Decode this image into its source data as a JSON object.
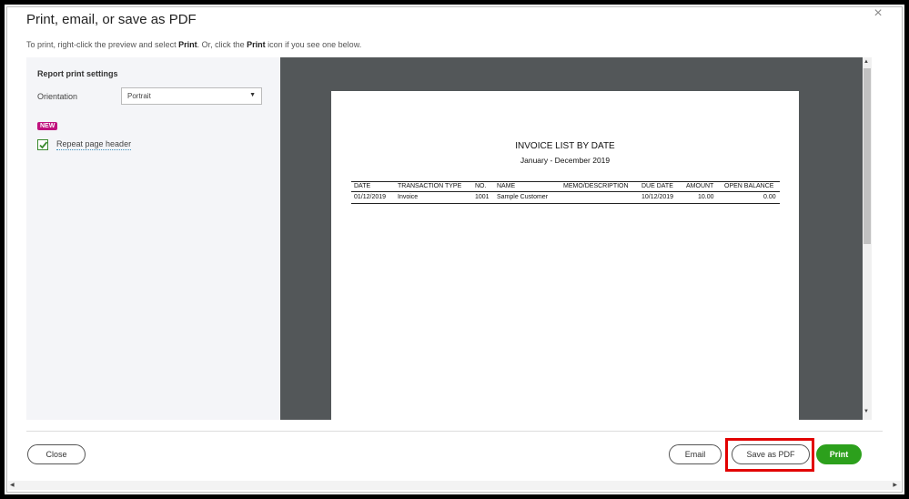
{
  "dialog": {
    "title": "Print, email, or save as PDF",
    "subtitle_pre": "To print, right-click the preview and select ",
    "subtitle_b1": "Print",
    "subtitle_mid": ". Or, click the ",
    "subtitle_b2": "Print",
    "subtitle_post": " icon if you see one below.",
    "close_icon": "×"
  },
  "settings": {
    "heading": "Report print settings",
    "orientation_label": "Orientation",
    "orientation_value": "Portrait",
    "new_badge": "NEW",
    "repeat_header_label": "Repeat page header",
    "repeat_header_checked": true
  },
  "report": {
    "title": "INVOICE LIST BY DATE",
    "subtitle": "January - December 2019",
    "columns": [
      "DATE",
      "TRANSACTION TYPE",
      "NO.",
      "NAME",
      "MEMO/DESCRIPTION",
      "DUE DATE",
      "AMOUNT",
      "OPEN BALANCE"
    ],
    "rows": [
      [
        "01/12/2019",
        "Invoice",
        "1001",
        "Sample Customer",
        "",
        "10/12/2019",
        "10.00",
        "0.00"
      ]
    ]
  },
  "footer": {
    "close_label": "Close",
    "email_label": "Email",
    "save_pdf_label": "Save as PDF",
    "print_label": "Print"
  },
  "colors": {
    "print_button": "#2ca01c",
    "new_badge": "#c0127e",
    "highlight": "#e20000",
    "preview_bg": "#535759"
  }
}
